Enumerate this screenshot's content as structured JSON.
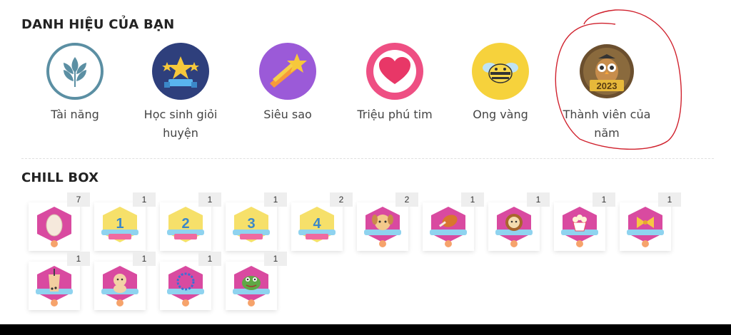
{
  "titles": {
    "badges": "DANH HIỆU CỦA BẠN",
    "chill_box": "CHILL BOX"
  },
  "badges": [
    {
      "label": "Tài năng",
      "icon": "leaf-icon"
    },
    {
      "label": "Học sinh giỏi huyện",
      "icon": "stars-trophy-icon"
    },
    {
      "label": "Siêu sao",
      "icon": "shooting-star-icon"
    },
    {
      "label": "Triệu phú tim",
      "icon": "heart-icon"
    },
    {
      "label": "Ong vàng",
      "icon": "bee-icon"
    },
    {
      "label": "Thành viên của năm",
      "icon": "owl-2023-icon",
      "year": "2023"
    }
  ],
  "chill_box": [
    {
      "count": "7",
      "icon": "egg-icon"
    },
    {
      "count": "1",
      "icon": "medal-1-icon",
      "text": "1"
    },
    {
      "count": "1",
      "icon": "medal-2-icon",
      "text": "2"
    },
    {
      "count": "1",
      "icon": "medal-3-icon",
      "text": "3"
    },
    {
      "count": "2",
      "icon": "medal-4-icon",
      "text": "4"
    },
    {
      "count": "2",
      "icon": "dog-icon"
    },
    {
      "count": "1",
      "icon": "chicken-leg-icon"
    },
    {
      "count": "1",
      "icon": "lion-icon"
    },
    {
      "count": "1",
      "icon": "popcorn-icon"
    },
    {
      "count": "1",
      "icon": "bow-icon"
    },
    {
      "count": "1",
      "icon": "bubble-tea-icon"
    },
    {
      "count": "1",
      "icon": "puppy-icon"
    },
    {
      "count": "1",
      "icon": "ring-icon"
    },
    {
      "count": "1",
      "icon": "frog-icon"
    }
  ],
  "colors": {
    "hexagon_pink": "#d94aa0",
    "ribbon_blue": "#8fd3ef",
    "annotation_red": "#d0212d"
  }
}
